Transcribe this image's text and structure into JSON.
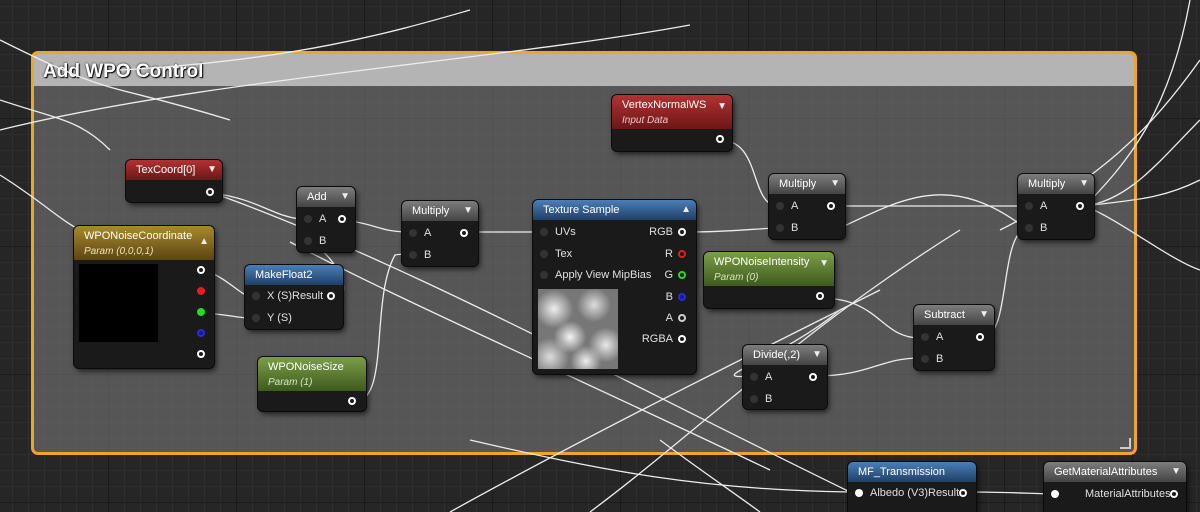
{
  "comment": {
    "title": "Add WPO Control"
  },
  "nodes": {
    "texcoord": {
      "title": "TexCoord[0]"
    },
    "wpo_noise_coordinate": {
      "title": "WPONoiseCoordinate",
      "subtitle": "Param (0,0,0,1)"
    },
    "add": {
      "title": "Add",
      "pins": [
        "A",
        "B"
      ]
    },
    "make_float2": {
      "title": "MakeFloat2",
      "pins": [
        "X (S)",
        "Y (S)"
      ],
      "output": "Result"
    },
    "wpo_noise_size": {
      "title": "WPONoiseSize",
      "subtitle": "Param (1)"
    },
    "multiply_1": {
      "title": "Multiply",
      "pins": [
        "A",
        "B"
      ]
    },
    "texture_sample": {
      "title": "Texture Sample",
      "inputs": [
        "UVs",
        "Tex",
        "Apply View MipBias"
      ],
      "outputs": [
        "RGB",
        "R",
        "G",
        "B",
        "A",
        "RGBA"
      ]
    },
    "vertex_normal_ws": {
      "title": "VertexNormalWS",
      "subtitle": "Input Data"
    },
    "multiply_2": {
      "title": "Multiply",
      "pins": [
        "A",
        "B"
      ]
    },
    "wpo_noise_intensity": {
      "title": "WPONoiseIntensity",
      "subtitle": "Param (0)"
    },
    "divide": {
      "title": "Divide(,2)",
      "pins": [
        "A",
        "B"
      ]
    },
    "subtract": {
      "title": "Subtract",
      "pins": [
        "A",
        "B"
      ]
    },
    "multiply_3": {
      "title": "Multiply",
      "pins": [
        "A",
        "B"
      ]
    },
    "mf_transmission": {
      "title": "MF_Transmission",
      "input": "Albedo (V3)",
      "output": "Result"
    },
    "get_material_attributes": {
      "title": "GetMaterialAttributes",
      "input": "MaterialAttributes"
    }
  },
  "colors": {
    "comment_border": "#f0a52a",
    "param_node": "#5c7a2e",
    "input_node": "#8c2020",
    "texture_node": "#2d5f8c"
  },
  "icons": {
    "collapse": "chevron-down-icon",
    "collapse_up": "chevron-up-icon"
  }
}
